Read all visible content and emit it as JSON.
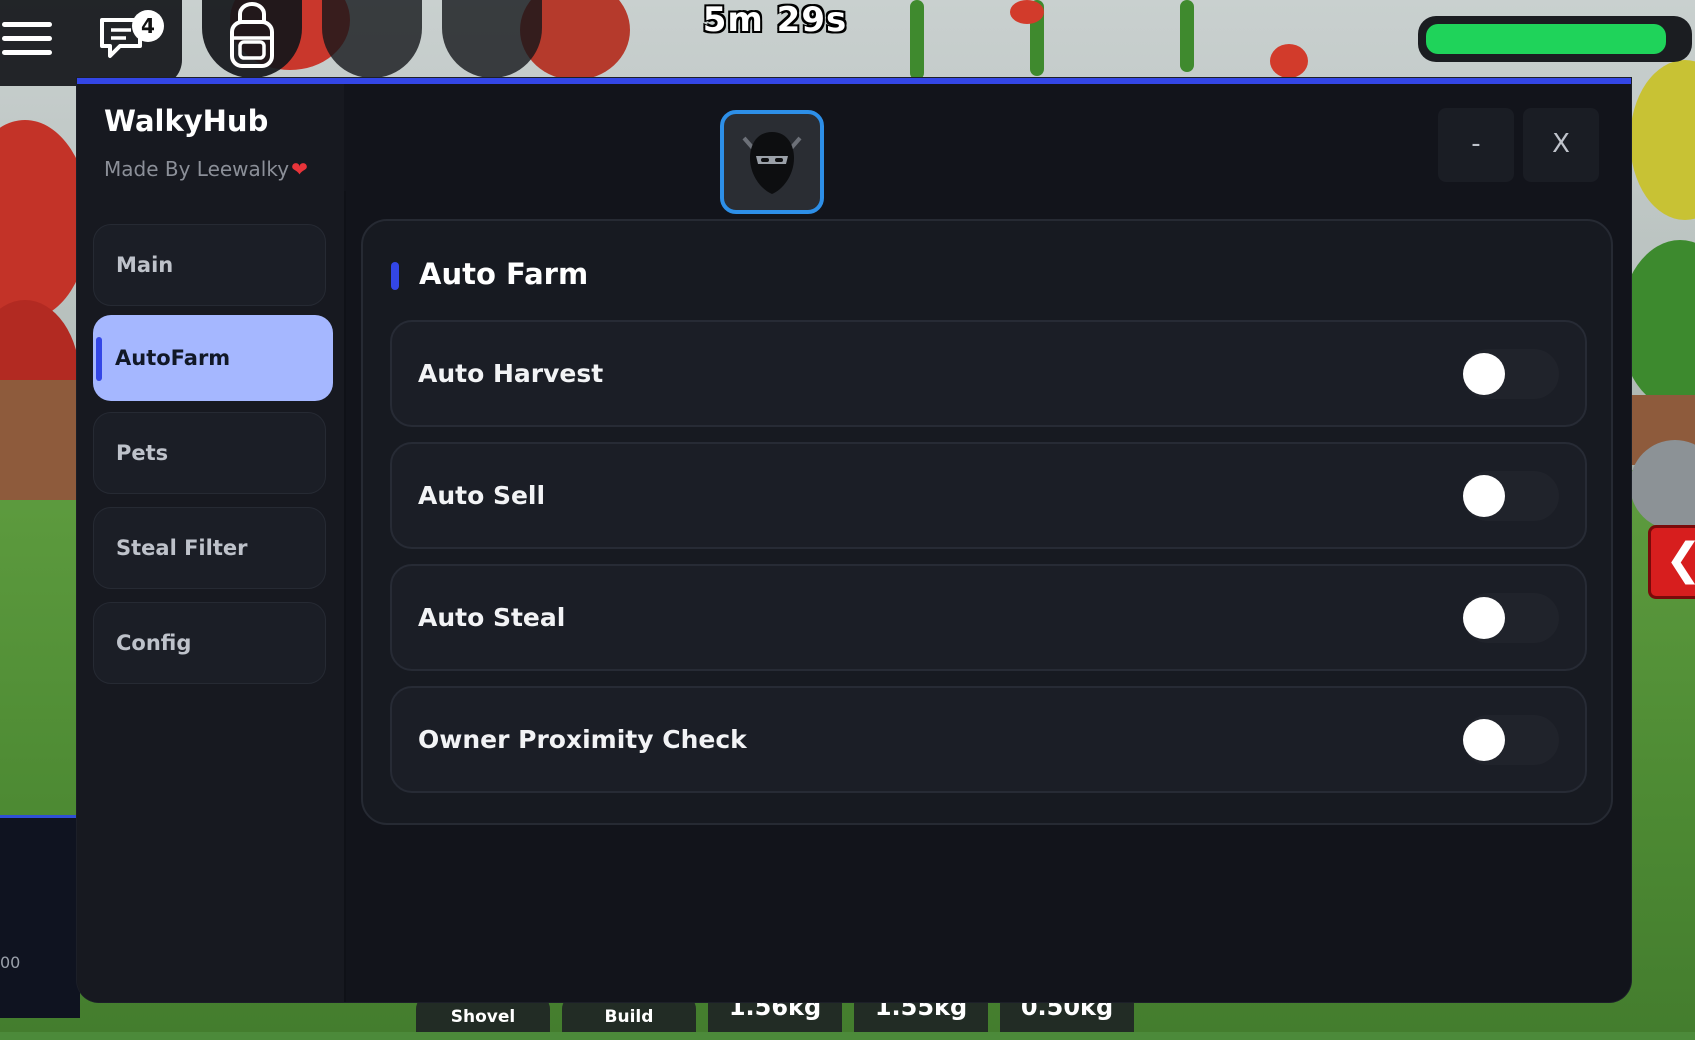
{
  "hud": {
    "chat_badge": "4",
    "timer": "5m 29s",
    "health_fraction": 0.93,
    "left_edge_text": "00"
  },
  "hotbar": {
    "tools": [
      "Shovel",
      "Build"
    ],
    "weights": [
      "1.56kg",
      "1.55kg",
      "0.50kg"
    ]
  },
  "window": {
    "title": "WalkyHub",
    "subtitle": "Made By Leewalky",
    "minimize_label": "-",
    "close_label": "X",
    "accent_color": "#3346e6"
  },
  "sidebar": {
    "items": [
      {
        "label": "Main",
        "active": false
      },
      {
        "label": "AutoFarm",
        "active": true
      },
      {
        "label": "Pets",
        "active": false
      },
      {
        "label": "Steal Filter",
        "active": false
      },
      {
        "label": "Config",
        "active": false
      }
    ]
  },
  "section": {
    "title": "Auto Farm",
    "toggles": [
      {
        "label": "Auto Harvest",
        "on": false
      },
      {
        "label": "Auto Sell",
        "on": false
      },
      {
        "label": "Auto Steal",
        "on": false
      },
      {
        "label": "Owner Proximity Check",
        "on": false
      }
    ]
  }
}
